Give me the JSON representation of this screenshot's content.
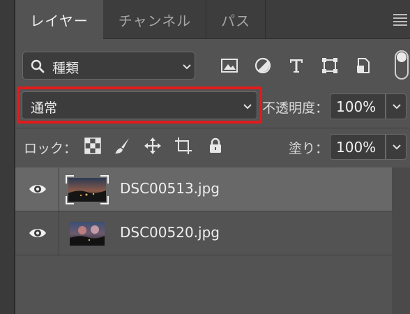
{
  "tabs": [
    {
      "label": "レイヤー",
      "active": true
    },
    {
      "label": "チャンネル",
      "active": false
    },
    {
      "label": "パス",
      "active": false
    }
  ],
  "filter": {
    "label": "種類",
    "icons": [
      "image-filter-icon",
      "adjustment-filter-icon",
      "type-filter-icon",
      "shape-filter-icon",
      "smart-object-filter-icon"
    ]
  },
  "blend": {
    "mode": "通常",
    "highlight_color": "#e3191a"
  },
  "opacity": {
    "label": "不透明度：",
    "value": "100%"
  },
  "lock": {
    "label": "ロック：",
    "icons": [
      "lock-transparent-pixels-icon",
      "lock-image-pixels-icon",
      "lock-position-icon",
      "lock-artboard-icon",
      "lock-all-icon"
    ]
  },
  "fill": {
    "label": "塗り：",
    "value": "100%"
  },
  "layers": [
    {
      "name": "DSC00513.jpg",
      "visible": true,
      "selected": true
    },
    {
      "name": "DSC00520.jpg",
      "visible": true,
      "selected": false
    }
  ],
  "colors": {
    "panel_bg": "#535353",
    "tab_bar_bg": "#3d3d3d",
    "selected_row_bg": "#686868"
  }
}
